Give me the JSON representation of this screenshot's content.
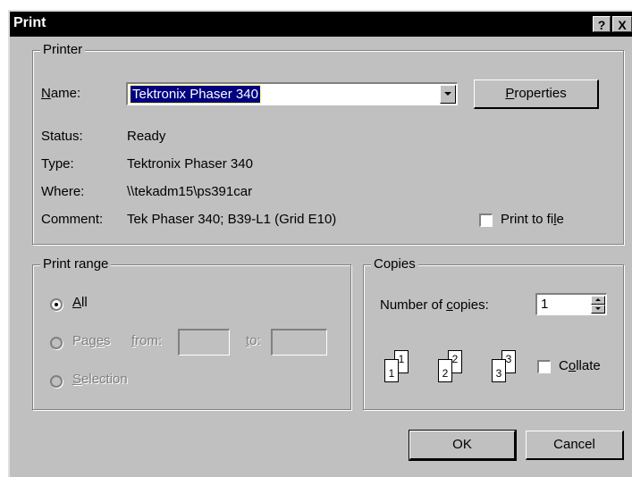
{
  "dialog": {
    "title": "Print",
    "help_button": "?",
    "close_button": "X"
  },
  "printer": {
    "group_label": "Printer",
    "name_label": "Name:",
    "name_value": "Tektronix Phaser 340",
    "properties_label": "Properties",
    "status_label": "Status:",
    "status_value": "Ready",
    "type_label": "Type:",
    "type_value": "Tektronix Phaser 340",
    "where_label": "Where:",
    "where_value": "\\\\tekadm15\\ps391car",
    "comment_label": "Comment:",
    "comment_value": "Tek Phaser 340; B39-L1 (Grid E10)",
    "print_to_file_label": "Print to file",
    "print_to_file_checked": false
  },
  "print_range": {
    "group_label": "Print range",
    "all_label": "All",
    "pages_label": "Pages",
    "from_label": "from:",
    "to_label": "to:",
    "selection_label": "Selection",
    "selected": "All"
  },
  "copies": {
    "group_label": "Copies",
    "number_label": "Number of copies:",
    "number_value": "1",
    "collate_label": "Collate",
    "collate_checked": false,
    "page_icon_numbers": [
      "1",
      "1",
      "2",
      "2",
      "3",
      "3"
    ]
  },
  "buttons": {
    "ok_label": "OK",
    "cancel_label": "Cancel"
  }
}
